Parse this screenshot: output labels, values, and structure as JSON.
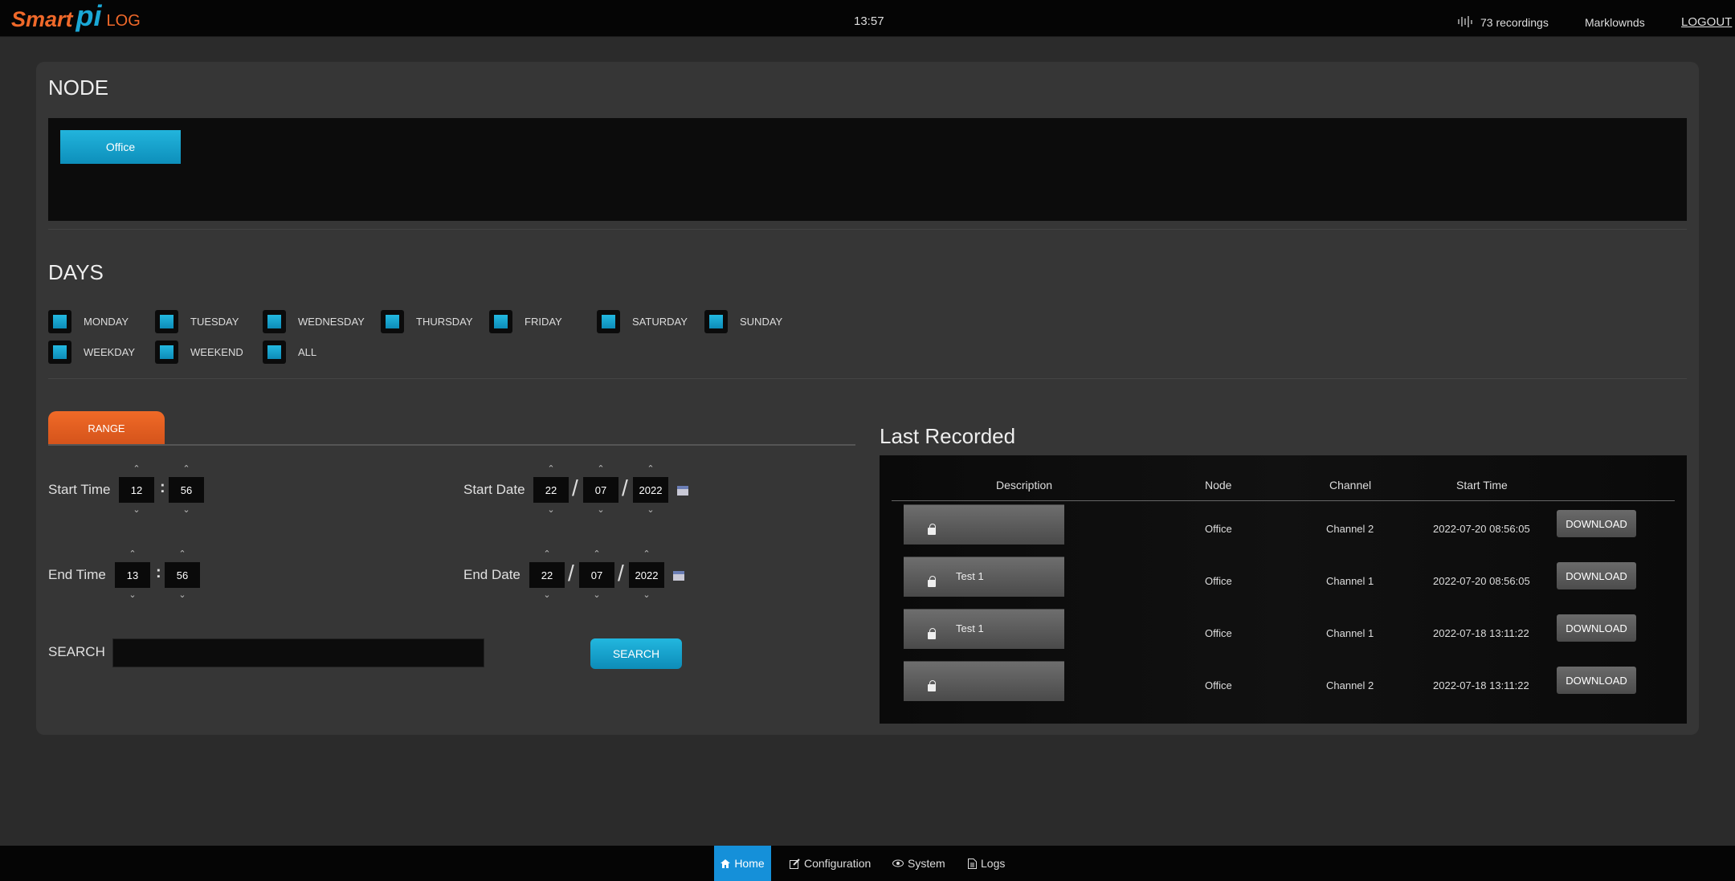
{
  "header": {
    "logo_smart": "Smart",
    "logo_pi": "pi",
    "logo_log": "LOG",
    "clock": "13:57",
    "recordings": "73 recordings",
    "user": "Marklownds",
    "logout": "LOGOUT"
  },
  "node": {
    "heading": "NODE",
    "nodes": [
      "Office"
    ]
  },
  "days": {
    "heading": "DAYS",
    "items": [
      "MONDAY",
      "TUESDAY",
      "WEDNESDAY",
      "THURSDAY",
      "FRIDAY",
      "SATURDAY",
      "SUNDAY",
      "WEEKDAY",
      "WEEKEND",
      "ALL"
    ]
  },
  "range": {
    "tab": "RANGE",
    "start_time_label": "Start Time",
    "start_hour": "12",
    "start_min": "56",
    "end_time_label": "End Time",
    "end_hour": "13",
    "end_min": "56",
    "start_date_label": "Start Date",
    "start_day": "22",
    "start_month": "07",
    "start_year": "2022",
    "end_date_label": "End Date",
    "end_day": "22",
    "end_month": "07",
    "end_year": "2022",
    "search_label": "SEARCH",
    "search_value": "",
    "search_button": "SEARCH"
  },
  "last_recorded": {
    "heading": "Last Recorded",
    "columns": [
      "Description",
      "Node",
      "Channel",
      "Start Time"
    ],
    "rows": [
      {
        "description": "",
        "node": "Office",
        "channel": "Channel 2",
        "start": "2022-07-20 08:56:05",
        "action": "DOWNLOAD"
      },
      {
        "description": "Test 1",
        "node": "Office",
        "channel": "Channel 1",
        "start": "2022-07-20 08:56:05",
        "action": "DOWNLOAD"
      },
      {
        "description": "Test 1",
        "node": "Office",
        "channel": "Channel 1",
        "start": "2022-07-18 13:11:22",
        "action": "DOWNLOAD"
      },
      {
        "description": "",
        "node": "Office",
        "channel": "Channel 2",
        "start": "2022-07-18 13:11:22",
        "action": "DOWNLOAD"
      }
    ]
  },
  "nav": {
    "items": [
      "Home",
      "Configuration",
      "System",
      "Logs"
    ],
    "active": "Home"
  },
  "colors": {
    "accent_blue": "#1aa8d6",
    "accent_orange": "#f0692a",
    "nav_active": "#1590d9"
  }
}
